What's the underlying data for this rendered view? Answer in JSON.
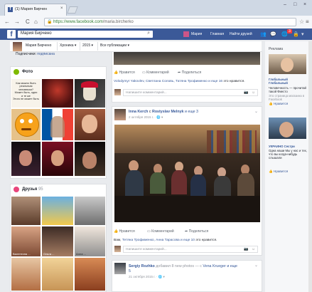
{
  "browser": {
    "tab_title": "(1) Мария Бирчен",
    "tab_close": "×",
    "url_host": "https://www.facebook.com",
    "url_path": "/maria.bircherko",
    "star": "☆",
    "menu": "≡"
  },
  "fb": {
    "logo": "f",
    "search_value": "Мария Бирчено",
    "user_name": "Мария",
    "home": "Главная",
    "find_friends": "Найти друзей",
    "notif_count": "3"
  },
  "profile_bar": {
    "name": "Мария Бирчено",
    "timeline": "Хроника",
    "year": "2015",
    "all_posts": "Все публикации"
  },
  "friends_line": {
    "prefix": "Подписчики:",
    "link": "подписана"
  },
  "photos": {
    "title": "Фото",
    "caption_lines": [
      "Как можно быть",
      "реальным человеком?",
      "Может быть, одни",
      "и те же",
      "Этого не может быть"
    ]
  },
  "friends": {
    "title": "Друзья",
    "count": "95",
    "names": [
      "",
      "",
      "",
      "Валентина ...",
      "Ольга ...",
      "Алла ...",
      "",
      "",
      ""
    ]
  },
  "post1": {
    "actions": [
      "Нравится",
      "Комментарий",
      "Поделиться"
    ],
    "likes_blue": "Volodymyr Yakovlev, Светлана Соловь, Татяна Трофименко",
    "likes_more": "и еще 16",
    "likes_tail": "это нравится.",
    "comment_ph": "Напишите комментарий..."
  },
  "post2": {
    "author": "Inna Kerch",
    "with_text": "с",
    "with_name": "Rostyslav Melnyk",
    "more": "и еще 3",
    "date": "2 октября 2015 г.",
    "actions": [
      "Нравится",
      "Комментарий",
      "Поделиться"
    ],
    "likes_prefix": "Вам,",
    "likes_blue": "Тетяна Трофименко, Анна Тарасова",
    "likes_more": "и еще 10",
    "likes_tail": "это нравится.",
    "comment_ph": "Напишите комментарий..."
  },
  "post3": {
    "author": "Sergiy Rozhko",
    "added": "добавил 8 new photos",
    "with": "— с",
    "with_name": "Vena Krueger",
    "more": "и еще",
    "extra": "5",
    "date": "21 октября 2015 г."
  },
  "right": {
    "ads_label": "Реклама",
    "ad1_title": "Глобальный Глобальный",
    "ad1_text": "Человечность — прочитай такой Фиесто",
    "ad1_sub": "Это страница магазина в Facebook",
    "ad1_like": "Нравится",
    "ad2_title": "УКРАИНО Сестри",
    "ad2_text": "Одна наши Мы у нас и тех, что вы когда-нибудь слышали",
    "ad2_like": "Нравится"
  },
  "colors": {
    "fb_blue": "#3b5998",
    "link": "#365899",
    "badge": "#fa3e3e"
  }
}
